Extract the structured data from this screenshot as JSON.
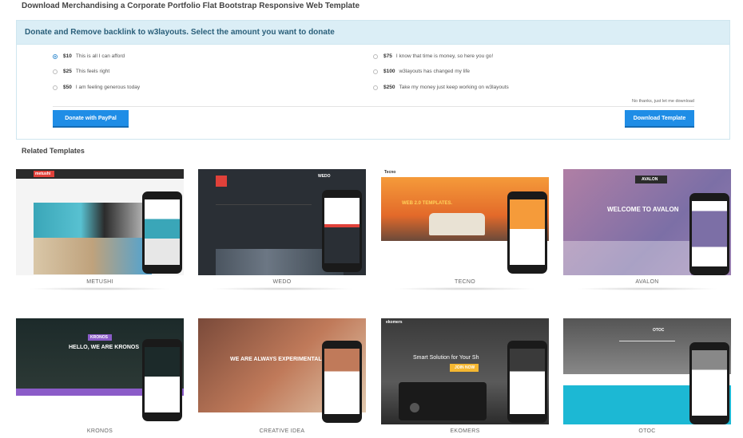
{
  "page": {
    "title": "Download Merchandising a Corporate Portfolio Flat Bootstrap Responsive Web Template"
  },
  "donate": {
    "header": "Donate and Remove backlink to w3layouts. Select the amount you want to donate",
    "options_left": [
      {
        "amount": "$10",
        "text": "This is all I can afford",
        "checked": true
      },
      {
        "amount": "$25",
        "text": "This feels right",
        "checked": false
      },
      {
        "amount": "$50",
        "text": "I am feeling generous today",
        "checked": false
      }
    ],
    "options_right": [
      {
        "amount": "$75",
        "text": "I know that time is money, so here you go!",
        "checked": false
      },
      {
        "amount": "$100",
        "text": "w3layouts has changed my life",
        "checked": false
      },
      {
        "amount": "$250",
        "text": "Take my money just keep working on w3layouts",
        "checked": false
      }
    ],
    "no_thanks": "No thanks, just let me download",
    "paypal_label": "Donate with PayPal",
    "download_label": "Download Template"
  },
  "related": {
    "title": "Related Templates",
    "templates": [
      {
        "name": "METUSHI",
        "logo": "metushi"
      },
      {
        "name": "WEDO",
        "logo": "WEDO"
      },
      {
        "name": "TECNO",
        "logo": "Tecno",
        "tagline": "WEB 2.0 TEMPLATES."
      },
      {
        "name": "AVALON",
        "logo": "AVALON",
        "tagline": "WELCOME TO AVALON"
      },
      {
        "name": "KRONOS",
        "logo": "KRONOS",
        "tagline": "HELLO, WE ARE KRONOS"
      },
      {
        "name": "CREATIVE IDEA",
        "tagline": "WE ARE ALWAYS EXPERIMENTAL"
      },
      {
        "name": "EKOMERS",
        "logo": "ekomers",
        "tagline": "Smart Solution for Your Sh",
        "cta": "JOIN NOW"
      },
      {
        "name": "OTOC",
        "logo": "OTOC"
      }
    ]
  },
  "colors": {
    "accent": "#1f8de6",
    "header_bg": "#dbeef6"
  }
}
